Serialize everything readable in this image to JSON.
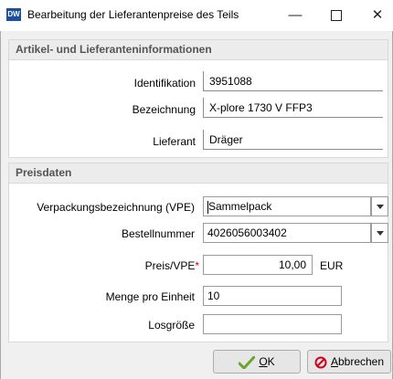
{
  "window": {
    "app_icon_text": "DW",
    "title": "Bearbeitung der Lieferantenpreise des Teils"
  },
  "article_group": {
    "header": "Artikel- und Lieferanteninformationen",
    "identification_label": "Identifikation",
    "identification_value": "3951088",
    "designation_label": "Bezeichnung",
    "designation_value": "X-plore 1730 V FFP3",
    "supplier_label": "Lieferant",
    "supplier_value": "Dräger"
  },
  "price_group": {
    "header": "Preisdaten",
    "packaging_label": "Verpackungsbezeichnung (VPE)",
    "packaging_value": "Sammelpack",
    "order_number_label": "Bestellnummer",
    "order_number_value": "4026056003402",
    "price_label": "Preis/VPE",
    "price_required_marker": "*",
    "price_value": "10,00",
    "price_currency": "EUR",
    "quantity_label": "Menge pro Einheit",
    "quantity_value": "10",
    "lot_size_label": "Losgröße",
    "lot_size_value": ""
  },
  "buttons": {
    "ok_underlined": "O",
    "ok_rest": "K",
    "cancel_underlined": "A",
    "cancel_rest": "bbrechen"
  },
  "colors": {
    "accent": "#1c4f9c",
    "required": "#d40000",
    "ok_icon": "#6aa52b",
    "cancel_icon": "#d0021b"
  }
}
